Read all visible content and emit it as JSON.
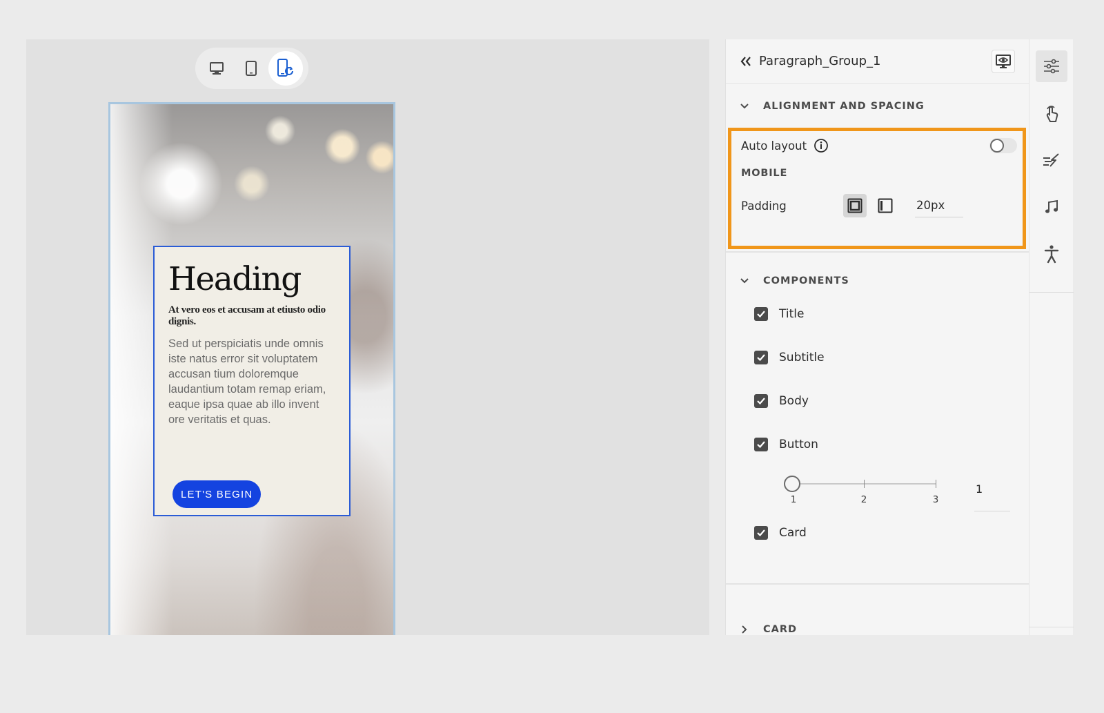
{
  "device_switcher": {
    "options": [
      {
        "name": "desktop",
        "icon": "desktop-icon",
        "active": false
      },
      {
        "name": "tablet",
        "icon": "tablet-icon",
        "active": false
      },
      {
        "name": "mobile",
        "icon": "mobile-rotate-icon",
        "active": true
      }
    ]
  },
  "preview_card": {
    "heading": "Heading",
    "subtitle": "At vero eos et accusam at etiusto odio dignis.",
    "body": "Sed ut perspiciatis unde omnis iste natus error sit voluptatem accusan tium doloremque laudantium totam remap eriam, eaque ipsa quae ab illo invent ore veritatis et quas.",
    "button_label": "LET'S BEGIN"
  },
  "panel": {
    "back_icon": "double-chevron-left-icon",
    "title": "Paragraph_Group_1",
    "preview_icon": "preview-icon",
    "alignment_section": {
      "label": "ALIGNMENT AND SPACING",
      "expanded": true,
      "auto_layout_label": "Auto layout",
      "auto_layout_enabled": false,
      "device_label": "MOBILE",
      "padding_label": "Padding",
      "padding_value": "20px"
    },
    "components_section": {
      "label": "COMPONENTS",
      "expanded": true,
      "items": [
        {
          "label": "Title",
          "checked": true
        },
        {
          "label": "Subtitle",
          "checked": true
        },
        {
          "label": "Body",
          "checked": true
        },
        {
          "label": "Button",
          "checked": true
        },
        {
          "label": "Card",
          "checked": true
        }
      ],
      "button_count_slider": {
        "ticks": [
          "1",
          "2",
          "3"
        ],
        "value": "1"
      }
    },
    "card_section": {
      "label": "CARD",
      "expanded": false
    }
  },
  "rail": {
    "items": [
      {
        "icon": "properties-icon",
        "active": true
      },
      {
        "icon": "interaction-icon",
        "active": false
      },
      {
        "icon": "animation-icon",
        "active": false
      },
      {
        "icon": "audio-icon",
        "active": false
      },
      {
        "icon": "accessibility-icon",
        "active": false
      }
    ]
  },
  "colors": {
    "highlight": "#f0961a",
    "card_button": "#1443e0",
    "card_border": "#2b5cd6"
  }
}
